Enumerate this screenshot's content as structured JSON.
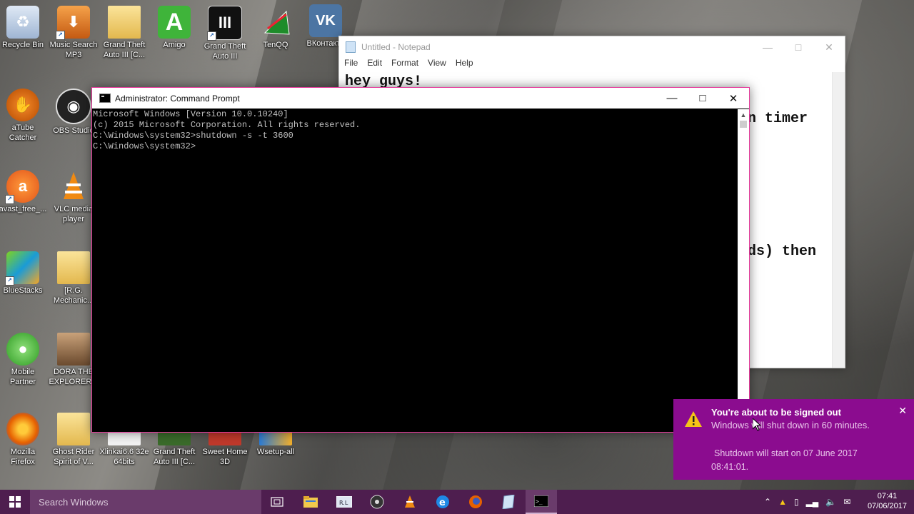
{
  "desktop": {
    "icons": [
      {
        "label": "Recycle Bin"
      },
      {
        "label": "Music Search MP3"
      },
      {
        "label": "Grand Theft Auto III [C..."
      },
      {
        "label": "Amigo"
      },
      {
        "label": "Grand Theft Auto III"
      },
      {
        "label": "TenQQ"
      },
      {
        "label": "ВКонтакте"
      },
      {
        "label": "aTube Catcher"
      },
      {
        "label": "OBS Studio"
      },
      {
        "label": "avast_free_..."
      },
      {
        "label": "VLC media player"
      },
      {
        "label": "BlueStacks"
      },
      {
        "label": "[R.G. Mechanic..."
      },
      {
        "label": "Mobile Partner"
      },
      {
        "label": "DORA THE EXPLORER..."
      },
      {
        "label": "Mozilla Firefox"
      },
      {
        "label": "Ghost Rider Spirit of V..."
      },
      {
        "label": "Xlinkai6.6 32e 64bits"
      },
      {
        "label": "Grand Theft Auto III [C..."
      },
      {
        "label": "Sweet Home 3D"
      },
      {
        "label": "Wsetup-all"
      }
    ]
  },
  "notepad": {
    "title": "Untitled - Notepad",
    "menu": [
      "File",
      "Edit",
      "Format",
      "View",
      "Help"
    ],
    "line1": "hey guys!",
    "frag1": "n timer",
    "frag2": "ds) then"
  },
  "cmd": {
    "title": "Administrator: Command Prompt",
    "lines": [
      "Microsoft Windows [Version 10.0.10240]",
      "(c) 2015 Microsoft Corporation. All rights reserved.",
      "",
      "C:\\Windows\\system32>shutdown -s -t 3600",
      "",
      "C:\\Windows\\system32>"
    ]
  },
  "toast": {
    "title": "You're about to be signed out",
    "message": "Windows will shut down in 60 minutes.",
    "detail": "Shutdown will start on 07 June 2017 08:41:01."
  },
  "taskbar": {
    "search_placeholder": "Search Windows",
    "time": "07:41",
    "date": "07/06/2017"
  },
  "colors": {
    "taskbar": "#4e1e4f",
    "toast": "#8b0c8f",
    "cmd_border": "#e53a9b"
  }
}
